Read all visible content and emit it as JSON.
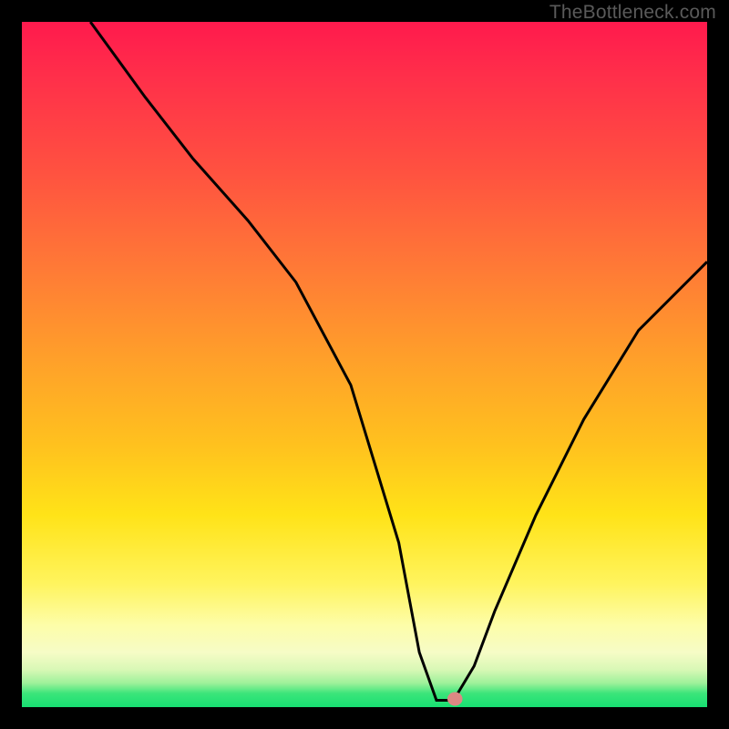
{
  "watermark": "TheBottleneck.com",
  "chart_data": {
    "type": "line",
    "title": "",
    "xlabel": "",
    "ylabel": "",
    "xlim": [
      0,
      100
    ],
    "ylim": [
      0,
      100
    ],
    "grid": false,
    "legend": false,
    "series": [
      {
        "name": "curve",
        "x": [
          10,
          18,
          25,
          33,
          40,
          48,
          55,
          58,
          60.5,
          63,
          66,
          69,
          75,
          82,
          90,
          100
        ],
        "y": [
          100,
          89,
          80,
          71,
          62,
          47,
          24,
          8,
          1,
          1,
          6,
          14,
          28,
          42,
          55,
          65
        ]
      }
    ],
    "marker": {
      "x": 63.2,
      "y": 1.2,
      "color": "#dd8884"
    }
  },
  "colors": {
    "frame": "#000000",
    "line": "#000000",
    "marker": "#dd8884",
    "watermark": "#5a5a5a"
  }
}
